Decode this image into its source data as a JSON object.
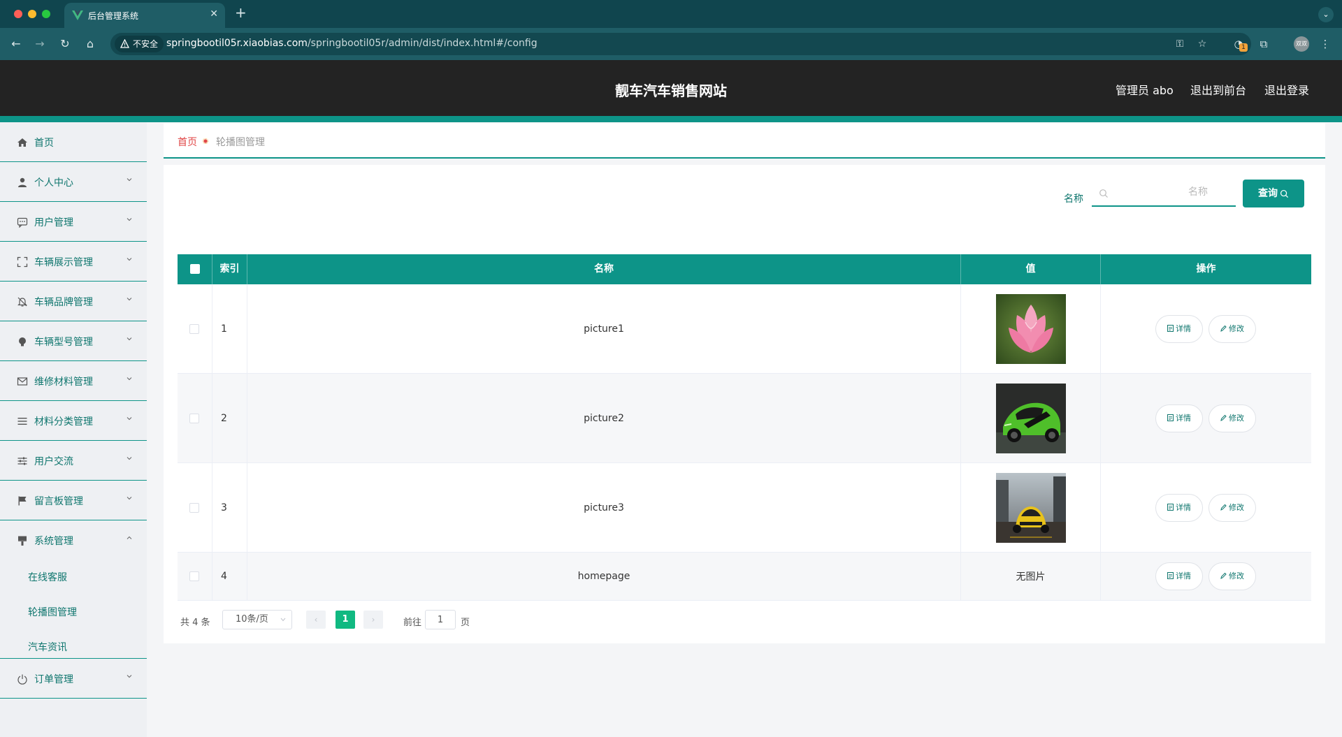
{
  "browser": {
    "tab_title": "后台管理系统",
    "insecure_label": "不安全",
    "url_host": "springbootil05r.xiaobias.com",
    "url_path": "/springbootil05r/admin/dist/index.html#/config",
    "extension_badge": "1",
    "profile_label": "双双"
  },
  "header": {
    "site_title": "靓车汽车销售网站",
    "admin_label": "管理员 abo",
    "back_to_front": "退出到前台",
    "logout": "退出登录"
  },
  "sidebar": {
    "items": [
      {
        "label": "首页",
        "icon": "home-icon"
      },
      {
        "label": "个人中心",
        "icon": "user-icon"
      },
      {
        "label": "用户管理",
        "icon": "chat-icon"
      },
      {
        "label": "车辆展示管理",
        "icon": "fullscreen-icon"
      },
      {
        "label": "车辆品牌管理",
        "icon": "bell-off-icon"
      },
      {
        "label": "车辆型号管理",
        "icon": "bulb-icon"
      },
      {
        "label": "维修材料管理",
        "icon": "mail-icon"
      },
      {
        "label": "材料分类管理",
        "icon": "menu-icon"
      },
      {
        "label": "用户交流",
        "icon": "sliders-icon"
      },
      {
        "label": "留言板管理",
        "icon": "flag-icon"
      },
      {
        "label": "系统管理",
        "icon": "brush-icon"
      },
      {
        "label": "订单管理",
        "icon": "power-icon"
      }
    ],
    "system_submenu": [
      "在线客服",
      "轮播图管理",
      "汽车资讯"
    ]
  },
  "breadcrumb": {
    "home": "首页",
    "current": "轮播图管理"
  },
  "search": {
    "label": "名称",
    "placeholder": "名称",
    "button_label": "查询"
  },
  "table": {
    "columns": [
      "索引",
      "名称",
      "值",
      "操作"
    ],
    "rows": [
      {
        "index": "1",
        "name": "picture1",
        "value": "image-lotus"
      },
      {
        "index": "2",
        "name": "picture2",
        "value": "image-green-car"
      },
      {
        "index": "3",
        "name": "picture3",
        "value": "image-yellow-car"
      },
      {
        "index": "4",
        "name": "homepage",
        "value": "无图片"
      }
    ],
    "detail_label": "详情",
    "edit_label": "修改"
  },
  "pagination": {
    "total_text": "共 4 条",
    "page_size": "10条/页",
    "current_page": "1",
    "goto_label": "前往",
    "goto_value": "1",
    "page_suffix": "页"
  },
  "colors": {
    "accent": "#0d9488",
    "header_bg": "#232323",
    "sidebar_bg": "#eef0f3",
    "breadcrumb_home": "#e04646",
    "pagination_active": "#10b981"
  }
}
